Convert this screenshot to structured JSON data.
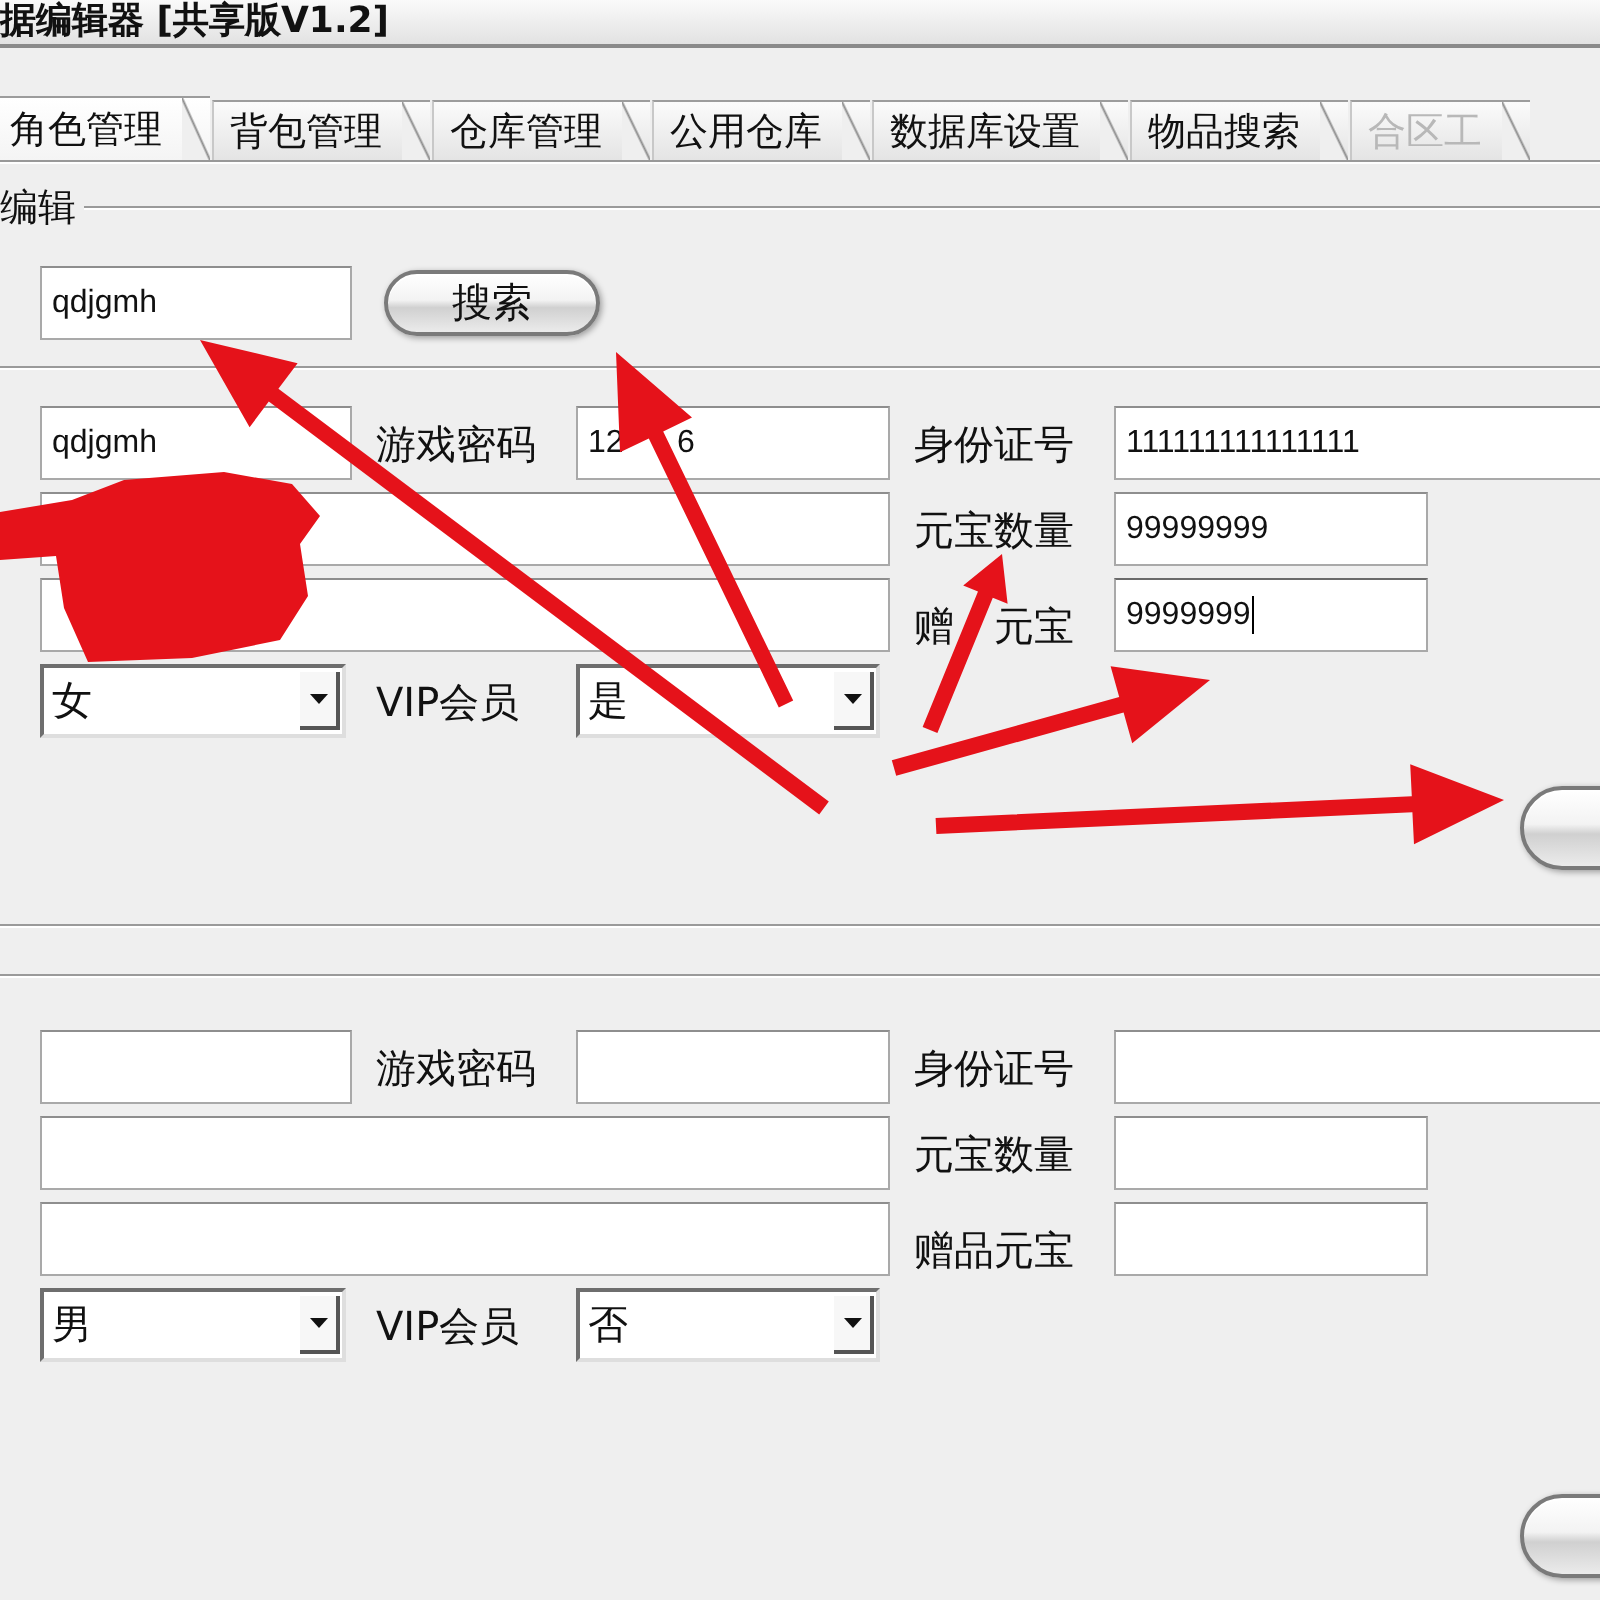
{
  "window": {
    "title": "据编辑器 [共享版V1.2]"
  },
  "tabs": [
    {
      "label": "角色管理",
      "selected": true,
      "disabled": false
    },
    {
      "label": "背包管理",
      "selected": false,
      "disabled": false
    },
    {
      "label": "仓库管理",
      "selected": false,
      "disabled": false
    },
    {
      "label": "公用仓库",
      "selected": false,
      "disabled": false
    },
    {
      "label": "数据库设置",
      "selected": false,
      "disabled": false
    },
    {
      "label": "物品搜索",
      "selected": false,
      "disabled": false
    },
    {
      "label": "合区工",
      "selected": false,
      "disabled": true
    }
  ],
  "edit_group": {
    "legend": "编辑",
    "search": {
      "value": "qdjgmh",
      "focused": false
    },
    "search_button": "搜索",
    "form": {
      "field_1": {
        "value": "qdjgmh",
        "focused": false
      },
      "password": {
        "label": "游戏密码",
        "value": "12      6",
        "focused": false
      },
      "id_number": {
        "label": "身份证号",
        "value": "111111111111111",
        "focused": false
      },
      "field_2": {
        "focused": false
      },
      "ingot_count": {
        "label": "元宝数量",
        "value": "99999999",
        "focused": false
      },
      "field_3": {
        "focused": false
      },
      "bonus_ingot": {
        "label": "赠　元宝",
        "value": "9999999",
        "focused": true
      },
      "select_1": {
        "value": "女"
      },
      "vip": {
        "label": "VIP会员",
        "value": "是"
      }
    }
  },
  "lower_form": {
    "field_1": {
      "focused": false
    },
    "password": {
      "label": "游戏密码",
      "focused": false
    },
    "id_number": {
      "label": "身份证号",
      "focused": false
    },
    "field_2": {
      "focused": false
    },
    "ingot_count": {
      "label": "元宝数量",
      "focused": false
    },
    "field_3": {
      "focused": false
    },
    "bonus_ingot": {
      "label": "赠品元宝",
      "focused": false
    },
    "select_1": {
      "value": "男"
    },
    "vip": {
      "label": "VIP会员",
      "value": "否"
    }
  }
}
